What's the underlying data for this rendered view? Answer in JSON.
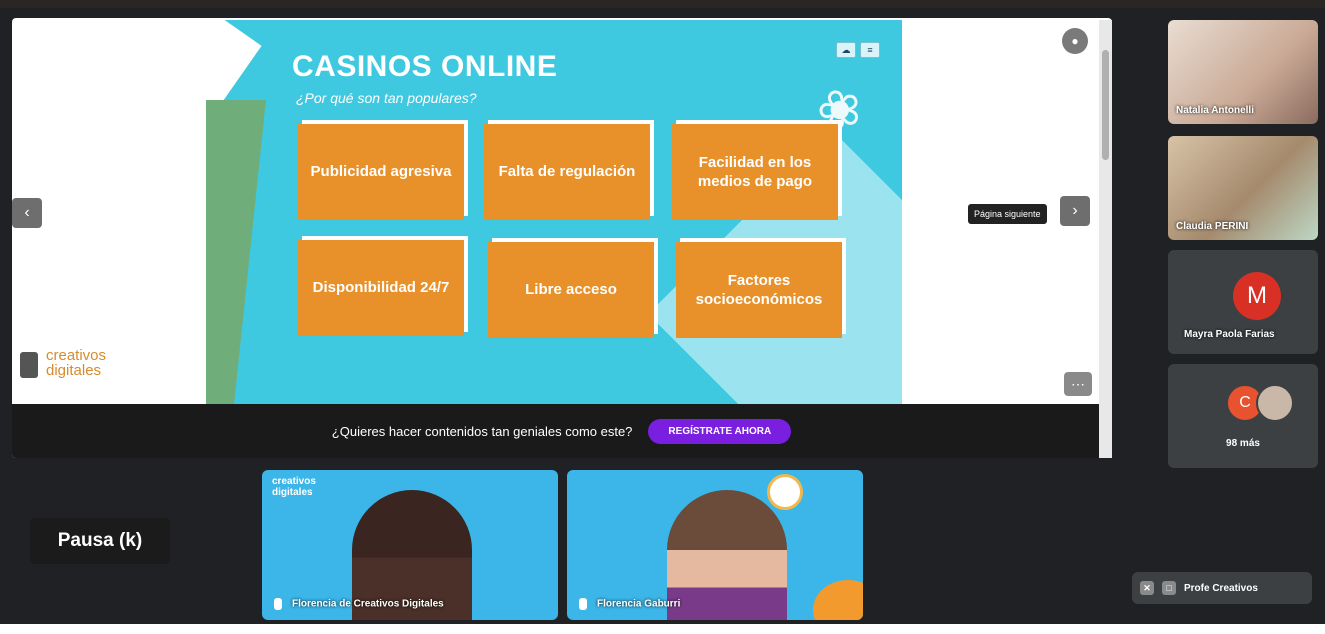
{
  "slide": {
    "title": "CASINOS ONLINE",
    "subtitle": "¿Por qué son tan populares?",
    "cards": [
      "Publicidad agresiva",
      "Falta de regulación",
      "Facilidad en los medios de pago",
      "Disponibilidad 24/7",
      "Libre acceso",
      "Factores socioeconómicos"
    ],
    "logo": [
      "creativos",
      "digitales"
    ]
  },
  "nav": {
    "prev_icon": "chevron-left-icon",
    "next_icon": "chevron-right-icon",
    "next_tooltip": "Página siguiente"
  },
  "cta": {
    "text": "¿Quieres hacer contenidos tan geniales como este?",
    "button": "REGÍSTRATE AHORA"
  },
  "participants": [
    {
      "name": "Natalia Antonelli"
    },
    {
      "name": "Claudia PERINI"
    },
    {
      "name": "Mayra Paola Farias",
      "initial": "M",
      "color": "#d93025"
    },
    {
      "initial": "C",
      "color": "#e8522f",
      "more_label": "98 más"
    }
  ],
  "videos": [
    {
      "name": "Florencia de Creativos Digitales",
      "logo": [
        "creativos",
        "digitales"
      ]
    },
    {
      "name": "Florencia Gaburri"
    }
  ],
  "pause_label": "Pausa (k)",
  "presenter_label": "Profe Creativos",
  "colors": {
    "slide_bg": "#3ec9e0",
    "card": "#e8912a",
    "cta_button": "#7a1fe0",
    "meet_bg": "#202124"
  }
}
